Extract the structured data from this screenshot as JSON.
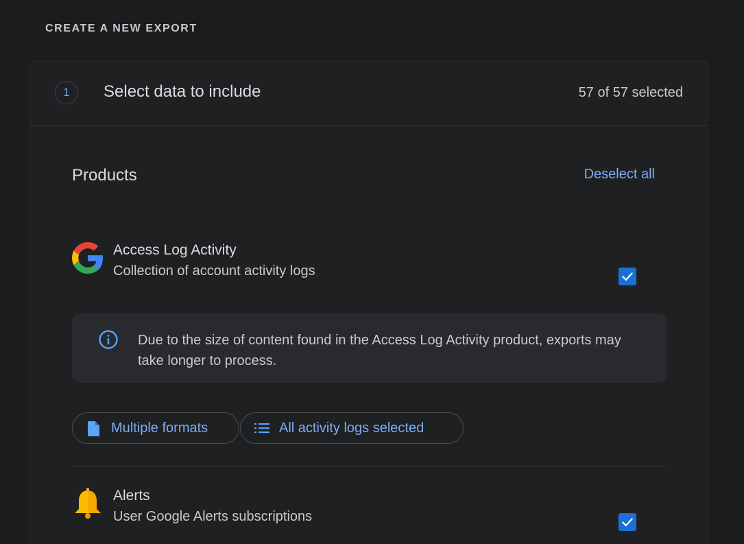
{
  "section_heading": "CREATE A NEW EXPORT",
  "step": {
    "number": "1",
    "title": "Select data to include",
    "count": "57 of 57 selected"
  },
  "products": {
    "title": "Products",
    "deselect_label": "Deselect all",
    "items": [
      {
        "name": "Access Log Activity",
        "description": "Collection of account activity logs",
        "checked": true,
        "icon": "google-g-icon",
        "notice": "Due to the size of content found in the Access Log Activity product, exports may take longer to process.",
        "chips": [
          {
            "label": "Multiple formats",
            "icon": "file-icon"
          },
          {
            "label": "All activity logs selected",
            "icon": "list-icon"
          }
        ]
      },
      {
        "name": "Alerts",
        "description": "User Google Alerts subscriptions",
        "checked": true,
        "icon": "bell-icon"
      }
    ]
  },
  "colors": {
    "background": "#1b1c1e",
    "accent": "#7cacf8",
    "checkbox": "#1a6fd8"
  }
}
